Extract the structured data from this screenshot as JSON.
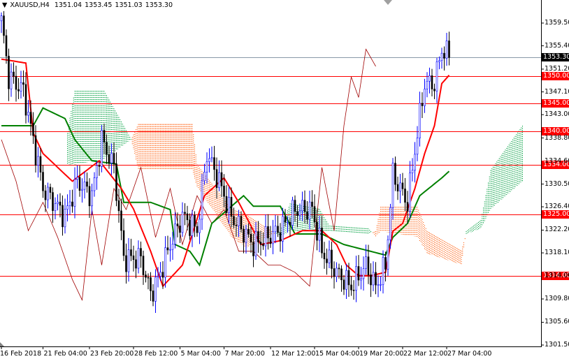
{
  "header": {
    "symbol": "XAUUSD,H4",
    "open": "1351.04",
    "high": "1353.45",
    "low": "1351.03",
    "close": "1353.30"
  },
  "chart_data": {
    "type": "candlestick",
    "symbol": "XAUUSD",
    "timeframe": "H4",
    "ylim": [
      1301.5,
      1359.5
    ],
    "y_ticks": [
      "1359.50",
      "1355.40",
      "1351.20",
      "1347.10",
      "1343.00",
      "1338.80",
      "1334.60",
      "1330.50",
      "1326.40",
      "1322.20",
      "1318.10",
      "1314.00",
      "1309.80",
      "1305.60",
      "1301.50"
    ],
    "x_ticks": [
      {
        "bar": 0,
        "label": "16 Feb 2018"
      },
      {
        "bar": 17,
        "label": "21 Feb 04:00"
      },
      {
        "bar": 36,
        "label": "23 Feb 20:00"
      },
      {
        "bar": 54,
        "label": "28 Feb 12:00"
      },
      {
        "bar": 73,
        "label": "5 Mar 04:00"
      },
      {
        "bar": 91,
        "label": "7 Mar 20:00"
      },
      {
        "bar": 110,
        "label": "12 Mar 12:00"
      },
      {
        "bar": 128,
        "label": "15 Mar 04:00"
      },
      {
        "bar": 146,
        "label": "19 Mar 20:00"
      },
      {
        "bar": 164,
        "label": "22 Mar 12:00"
      },
      {
        "bar": 182,
        "label": "27 Mar 04:00"
      }
    ],
    "current_price": {
      "value": 1353.3,
      "label": "1353.30",
      "color": "#000000"
    },
    "levels": [
      {
        "value": 1350.0,
        "label": "1350.00"
      },
      {
        "value": 1345.0,
        "label": "1345.00"
      },
      {
        "value": 1340.0,
        "label": "1340.00"
      },
      {
        "value": 1334.0,
        "label": "1334.00"
      },
      {
        "value": 1325.0,
        "label": "1325.00"
      },
      {
        "value": 1314.0,
        "label": "1314.00"
      }
    ],
    "level_color": "#ff0000",
    "close_path": [
      [
        0,
        1359.9
      ],
      [
        3,
        1349.8
      ],
      [
        9,
        1347.3
      ],
      [
        13,
        1338.5
      ],
      [
        17,
        1329.7
      ],
      [
        26,
        1324.7
      ],
      [
        31,
        1331
      ],
      [
        37,
        1328.4
      ],
      [
        41,
        1338.5
      ],
      [
        46,
        1333.5
      ],
      [
        50,
        1317.1
      ],
      [
        57,
        1317.1
      ],
      [
        61,
        1310.8
      ],
      [
        64,
        1313.3
      ],
      [
        69,
        1319.6
      ],
      [
        74,
        1324.7
      ],
      [
        80,
        1322.2
      ],
      [
        84,
        1336
      ],
      [
        89,
        1331
      ],
      [
        94,
        1324.7
      ],
      [
        103,
        1319.6
      ],
      [
        109,
        1321
      ],
      [
        114,
        1322.2
      ],
      [
        120,
        1325.9
      ],
      [
        127,
        1325.9
      ],
      [
        131,
        1318.4
      ],
      [
        137,
        1314.6
      ],
      [
        143,
        1312
      ],
      [
        149,
        1315.8
      ],
      [
        153,
        1312
      ],
      [
        157,
        1315.8
      ],
      [
        160,
        1332.2
      ],
      [
        166,
        1327.1
      ],
      [
        170,
        1339.7
      ],
      [
        173,
        1348.6
      ],
      [
        177,
        1348.6
      ],
      [
        180,
        1354.8
      ],
      [
        183,
        1353.3
      ]
    ],
    "tenkan": {
      "color": "#ff0000",
      "points": [
        [
          0,
          1353
        ],
        [
          10,
          1352.3
        ],
        [
          13,
          1339.7
        ],
        [
          17,
          1336
        ],
        [
          23,
          1333.5
        ],
        [
          29,
          1331
        ],
        [
          40,
          1334.7
        ],
        [
          49,
          1329.7
        ],
        [
          54,
          1326
        ],
        [
          61,
          1318.4
        ],
        [
          66,
          1312.1
        ],
        [
          74,
          1315.9
        ],
        [
          83,
          1328.4
        ],
        [
          91,
          1331.6
        ],
        [
          97,
          1327.2
        ],
        [
          106,
          1319.6
        ],
        [
          114,
          1320.3
        ],
        [
          123,
          1322.1
        ],
        [
          131,
          1322.1
        ],
        [
          137,
          1319.6
        ],
        [
          141,
          1315.9
        ],
        [
          146,
          1314
        ],
        [
          151,
          1314
        ],
        [
          157,
          1314.6
        ],
        [
          160,
          1322
        ],
        [
          164,
          1323.4
        ],
        [
          169,
          1329.7
        ],
        [
          173,
          1336
        ],
        [
          177,
          1341
        ],
        [
          180,
          1348.6
        ],
        [
          183,
          1350.1
        ]
      ]
    },
    "kijun": {
      "color": "#008000",
      "points": [
        [
          0,
          1341
        ],
        [
          13,
          1341
        ],
        [
          17,
          1344.2
        ],
        [
          26,
          1342.3
        ],
        [
          30,
          1338.5
        ],
        [
          37,
          1334.7
        ],
        [
          47,
          1334.1
        ],
        [
          50,
          1327.2
        ],
        [
          61,
          1327.2
        ],
        [
          69,
          1325.9
        ],
        [
          71,
          1319.6
        ],
        [
          77,
          1318.4
        ],
        [
          81,
          1315.9
        ],
        [
          86,
          1323.4
        ],
        [
          99,
          1328.4
        ],
        [
          103,
          1326.5
        ],
        [
          114,
          1326.5
        ],
        [
          120,
          1321.5
        ],
        [
          131,
          1321.5
        ],
        [
          140,
          1319.6
        ],
        [
          157,
          1317.7
        ],
        [
          160,
          1320.9
        ],
        [
          166,
          1323.4
        ],
        [
          171,
          1328.4
        ],
        [
          180,
          1331.6
        ],
        [
          183,
          1332.8
        ]
      ]
    },
    "chikou": {
      "color": "#a00000",
      "points": [
        [
          0,
          1338.5
        ],
        [
          6,
          1331
        ],
        [
          11,
          1322.1
        ],
        [
          17,
          1327.2
        ],
        [
          23,
          1320.9
        ],
        [
          29,
          1313.3
        ],
        [
          33,
          1309.6
        ],
        [
          37,
          1325.9
        ],
        [
          41,
          1315.9
        ],
        [
          46,
          1329.7
        ],
        [
          51,
          1325.9
        ],
        [
          57,
          1333.5
        ],
        [
          63,
          1320.9
        ],
        [
          69,
          1329.7
        ],
        [
          74,
          1319.6
        ],
        [
          80,
          1328.4
        ],
        [
          86,
          1323.4
        ],
        [
          91,
          1325.9
        ],
        [
          97,
          1318.4
        ],
        [
          103,
          1318.4
        ],
        [
          109,
          1315.9
        ],
        [
          114,
          1315.9
        ],
        [
          120,
          1314.6
        ],
        [
          126,
          1312.1
        ],
        [
          131,
          1333.5
        ],
        [
          136,
          1322.1
        ],
        [
          140,
          1341
        ],
        [
          143,
          1349.8
        ],
        [
          146,
          1346.1
        ],
        [
          149,
          1354.8
        ],
        [
          153,
          1351.7
        ]
      ]
    },
    "span_a": [
      [
        27,
        1340
      ],
      [
        30,
        1347.3
      ],
      [
        42,
        1347.3
      ],
      [
        53,
        1338.6
      ],
      [
        56,
        1333
      ],
      [
        78,
        1333
      ],
      [
        80,
        1330
      ],
      [
        94,
        1321
      ],
      [
        100,
        1319
      ],
      [
        114,
        1322
      ],
      [
        118,
        1327
      ],
      [
        130,
        1326
      ],
      [
        134,
        1323
      ],
      [
        150,
        1322.5
      ],
      [
        153,
        1321
      ],
      [
        155,
        1322
      ],
      [
        170,
        1321
      ],
      [
        174,
        1318
      ],
      [
        188,
        1316
      ],
      [
        190,
        1322
      ],
      [
        196,
        1324
      ],
      [
        200,
        1333
      ],
      [
        213,
        1341
      ]
    ],
    "span_b": [
      [
        27,
        1334
      ],
      [
        30,
        1334
      ],
      [
        42,
        1335
      ],
      [
        53,
        1338.5
      ],
      [
        56,
        1341.3
      ],
      [
        78,
        1341.3
      ],
      [
        80,
        1334
      ],
      [
        94,
        1326
      ],
      [
        100,
        1325
      ],
      [
        114,
        1321
      ],
      [
        118,
        1322
      ],
      [
        130,
        1322
      ],
      [
        134,
        1322
      ],
      [
        150,
        1321.5
      ],
      [
        153,
        1322
      ],
      [
        155,
        1326.4
      ],
      [
        170,
        1326.4
      ],
      [
        174,
        1322
      ],
      [
        188,
        1318.5
      ],
      [
        190,
        1321.5
      ],
      [
        196,
        1322.5
      ],
      [
        200,
        1326
      ],
      [
        213,
        1331
      ]
    ],
    "cloud_bull_color": "#00a040",
    "cloud_bear_color": "#ff6010"
  }
}
